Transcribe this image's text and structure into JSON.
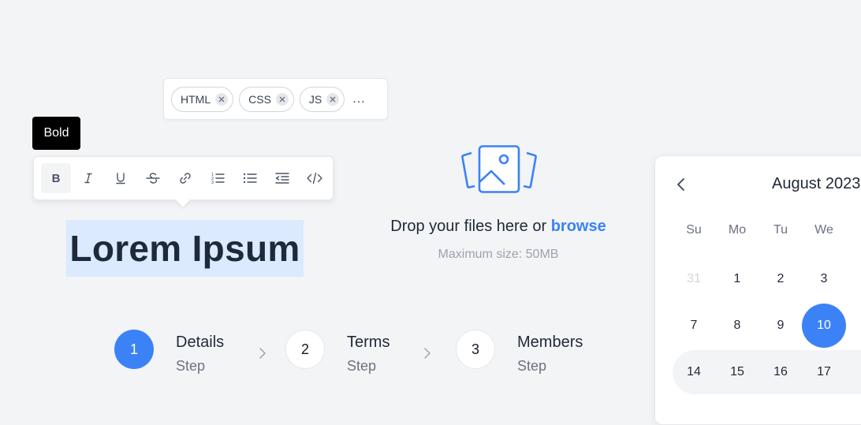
{
  "tags": {
    "items": [
      {
        "label": "HTML"
      },
      {
        "label": "CSS"
      },
      {
        "label": "JS"
      }
    ],
    "more": "..."
  },
  "tooltip": {
    "text": "Bold"
  },
  "toolbar": {
    "buttons": [
      {
        "icon": "bold-icon",
        "active": true
      },
      {
        "icon": "italic-icon"
      },
      {
        "icon": "underline-icon"
      },
      {
        "icon": "strikethrough-icon"
      },
      {
        "icon": "link-icon"
      },
      {
        "icon": "ordered-list-icon"
      },
      {
        "icon": "bullet-list-icon"
      },
      {
        "icon": "indent-icon"
      },
      {
        "icon": "code-icon"
      }
    ]
  },
  "editor": {
    "heading": "Lorem Ipsum"
  },
  "dropzone": {
    "icon": "images-icon",
    "text": "Drop your files here or",
    "link": "browse",
    "subtext": "Maximum size: 50MB"
  },
  "stepper": {
    "steps": [
      {
        "number": "1",
        "title": "Details",
        "subtitle": "Step",
        "active": true
      },
      {
        "number": "2",
        "title": "Terms",
        "subtitle": "Step"
      },
      {
        "number": "3",
        "title": "Members",
        "subtitle": "Step"
      }
    ]
  },
  "calendar": {
    "title": "August 2023",
    "weekdays": [
      "Su",
      "Mo",
      "Tu",
      "We"
    ],
    "rows": [
      [
        "31",
        "1",
        "2",
        "3"
      ],
      [
        "7",
        "8",
        "9",
        "10"
      ],
      [
        "14",
        "15",
        "16",
        "17"
      ]
    ],
    "selected": "10",
    "accent": "#3b82f6"
  }
}
